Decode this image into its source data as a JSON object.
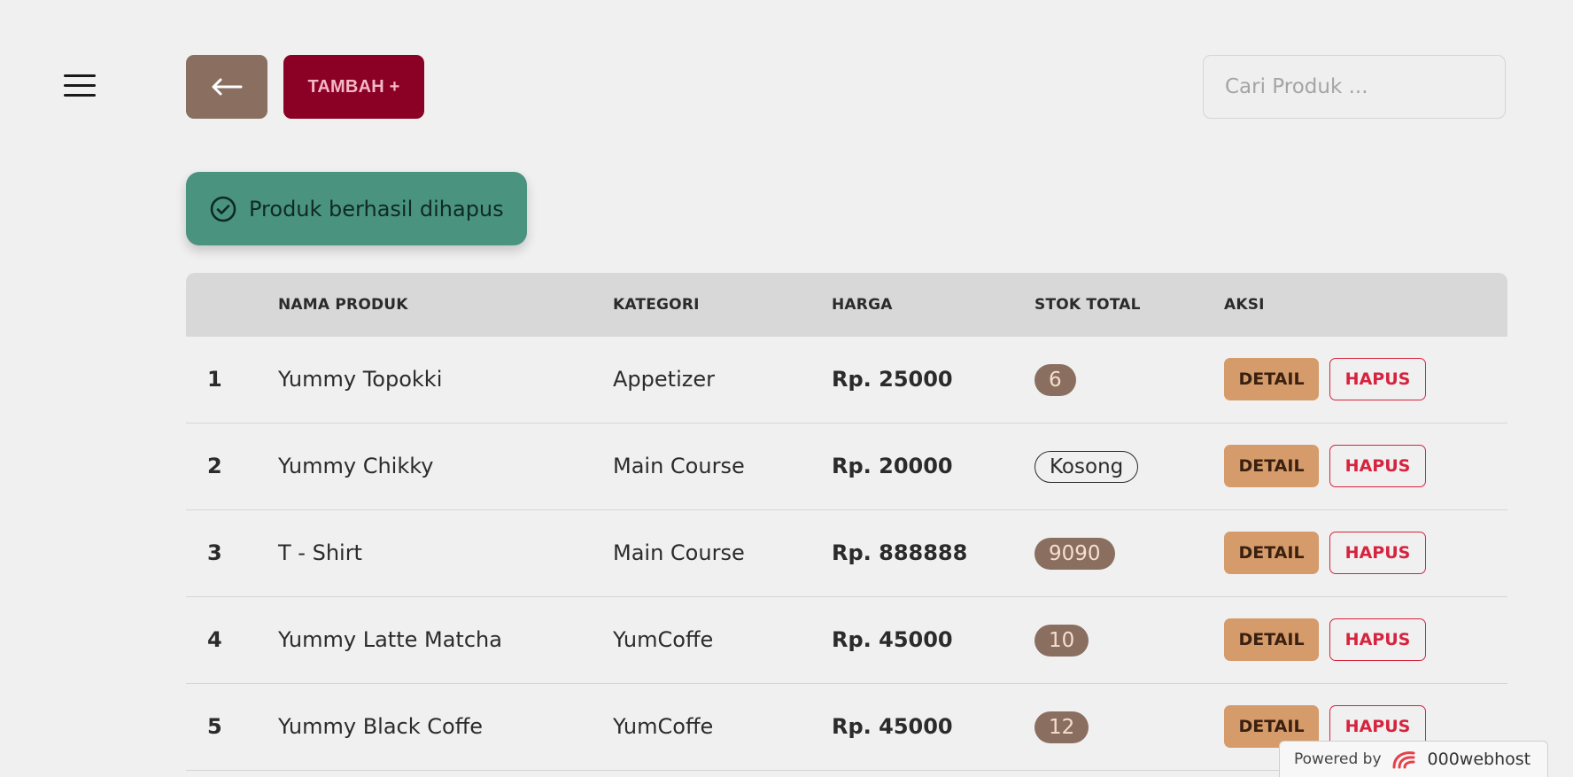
{
  "toolbar": {
    "back_icon": "arrow-left-icon",
    "add_label": "TAMBAH +"
  },
  "search": {
    "placeholder": "Cari Produk ...",
    "value": ""
  },
  "alert": {
    "icon": "check-circle-icon",
    "message": "Produk berhasil dihapus",
    "color": "#4a937f"
  },
  "table": {
    "headers": {
      "num": "",
      "name": "NAMA PRODUK",
      "category": "KATEGORI",
      "price": "HARGA",
      "stock": "STOK TOTAL",
      "actions": "AKSI"
    },
    "rows": [
      {
        "num": "1",
        "name": "Yummy Topokki",
        "category": "Appetizer",
        "price": "Rp. 25000",
        "stock": "6",
        "stock_empty": false,
        "detail": "DETAIL",
        "delete": "HAPUS"
      },
      {
        "num": "2",
        "name": "Yummy Chikky",
        "category": "Main Course",
        "price": "Rp. 20000",
        "stock": "Kosong",
        "stock_empty": true,
        "detail": "DETAIL",
        "delete": "HAPUS"
      },
      {
        "num": "3",
        "name": "T - Shirt",
        "category": "Main Course",
        "price": "Rp. 888888",
        "stock": "9090",
        "stock_empty": false,
        "detail": "DETAIL",
        "delete": "HAPUS"
      },
      {
        "num": "4",
        "name": "Yummy Latte Matcha",
        "category": "YumCoffe",
        "price": "Rp. 45000",
        "stock": "10",
        "stock_empty": false,
        "detail": "DETAIL",
        "delete": "HAPUS"
      },
      {
        "num": "5",
        "name": "Yummy Black Coffe",
        "category": "YumCoffe",
        "price": "Rp. 45000",
        "stock": "12",
        "stock_empty": false,
        "detail": "DETAIL",
        "delete": "HAPUS"
      }
    ]
  },
  "footer": {
    "powered_by": "Powered by",
    "brand": "000webhost"
  },
  "colors": {
    "background": "#f0f0f0",
    "back_button": "#8a6e60",
    "add_button": "#8b0025",
    "detail_button": "#d69b6a",
    "delete_button": "#d6233e",
    "stock_badge": "#8a6e60"
  }
}
